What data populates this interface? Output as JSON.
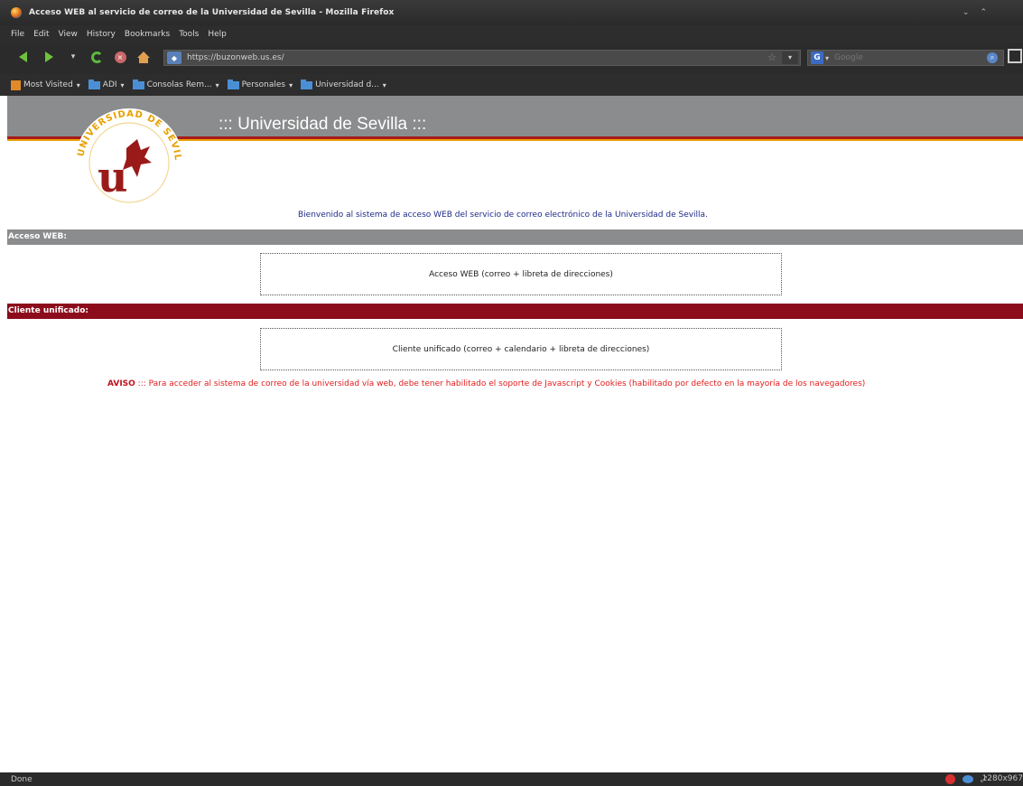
{
  "window": {
    "title": "Acceso WEB al servicio de correo de la Universidad de Sevilla - Mozilla Firefox",
    "controls": [
      "⌄",
      "⌃"
    ]
  },
  "menu": [
    "File",
    "Edit",
    "View",
    "History",
    "Bookmarks",
    "Tools",
    "Help"
  ],
  "navbar": {
    "url": "https://buzonweb.us.es/",
    "search_placeholder": "Google",
    "icons": [
      "back-arrow-icon",
      "forward-arrow-icon",
      "reload-icon",
      "stop-icon",
      "home-icon",
      "bookmark-star-icon",
      "search-engine-icon",
      "search-icon"
    ]
  },
  "bookmarks": [
    {
      "label": "Most Visited",
      "icon": "most-visited-icon"
    },
    {
      "label": "ADI",
      "icon": "folder-icon"
    },
    {
      "label": "Consolas Rem...",
      "icon": "folder-icon"
    },
    {
      "label": "Personales",
      "icon": "folder-icon"
    },
    {
      "label": "Universidad d...",
      "icon": "folder-icon"
    }
  ],
  "page": {
    "header_title": "::: Universidad de Sevilla :::",
    "logo_text": "UNIVERSIDAD DE SEVILLA",
    "welcome": "Bienvenido al sistema de acceso WEB del servicio de correo electrónico de la Universidad de Sevilla.",
    "section_web": {
      "title": "Acceso WEB:",
      "link": "Acceso WEB (correo + libreta de direcciones)"
    },
    "section_cliente": {
      "title": "Cliente unificado:",
      "link": "Cliente unificado (correo + calendario + libreta de direcciones)"
    },
    "aviso_label": "AVISO",
    "aviso_text": " ::: Para acceder al sistema de correo de la universidad vía web, debe tener habilitado el soporte de Javascript y Cookies (habilitado por defecto en la mayoría de los navegadores)"
  },
  "status": {
    "text": "Done",
    "resolution": "1280x967"
  },
  "colors": {
    "header_gray": "#8a8c8d",
    "us_red": "#8c0c1c",
    "gold": "#e8a000",
    "welcome_blue": "#1e2a8a",
    "aviso_red": "#e31c1c"
  }
}
